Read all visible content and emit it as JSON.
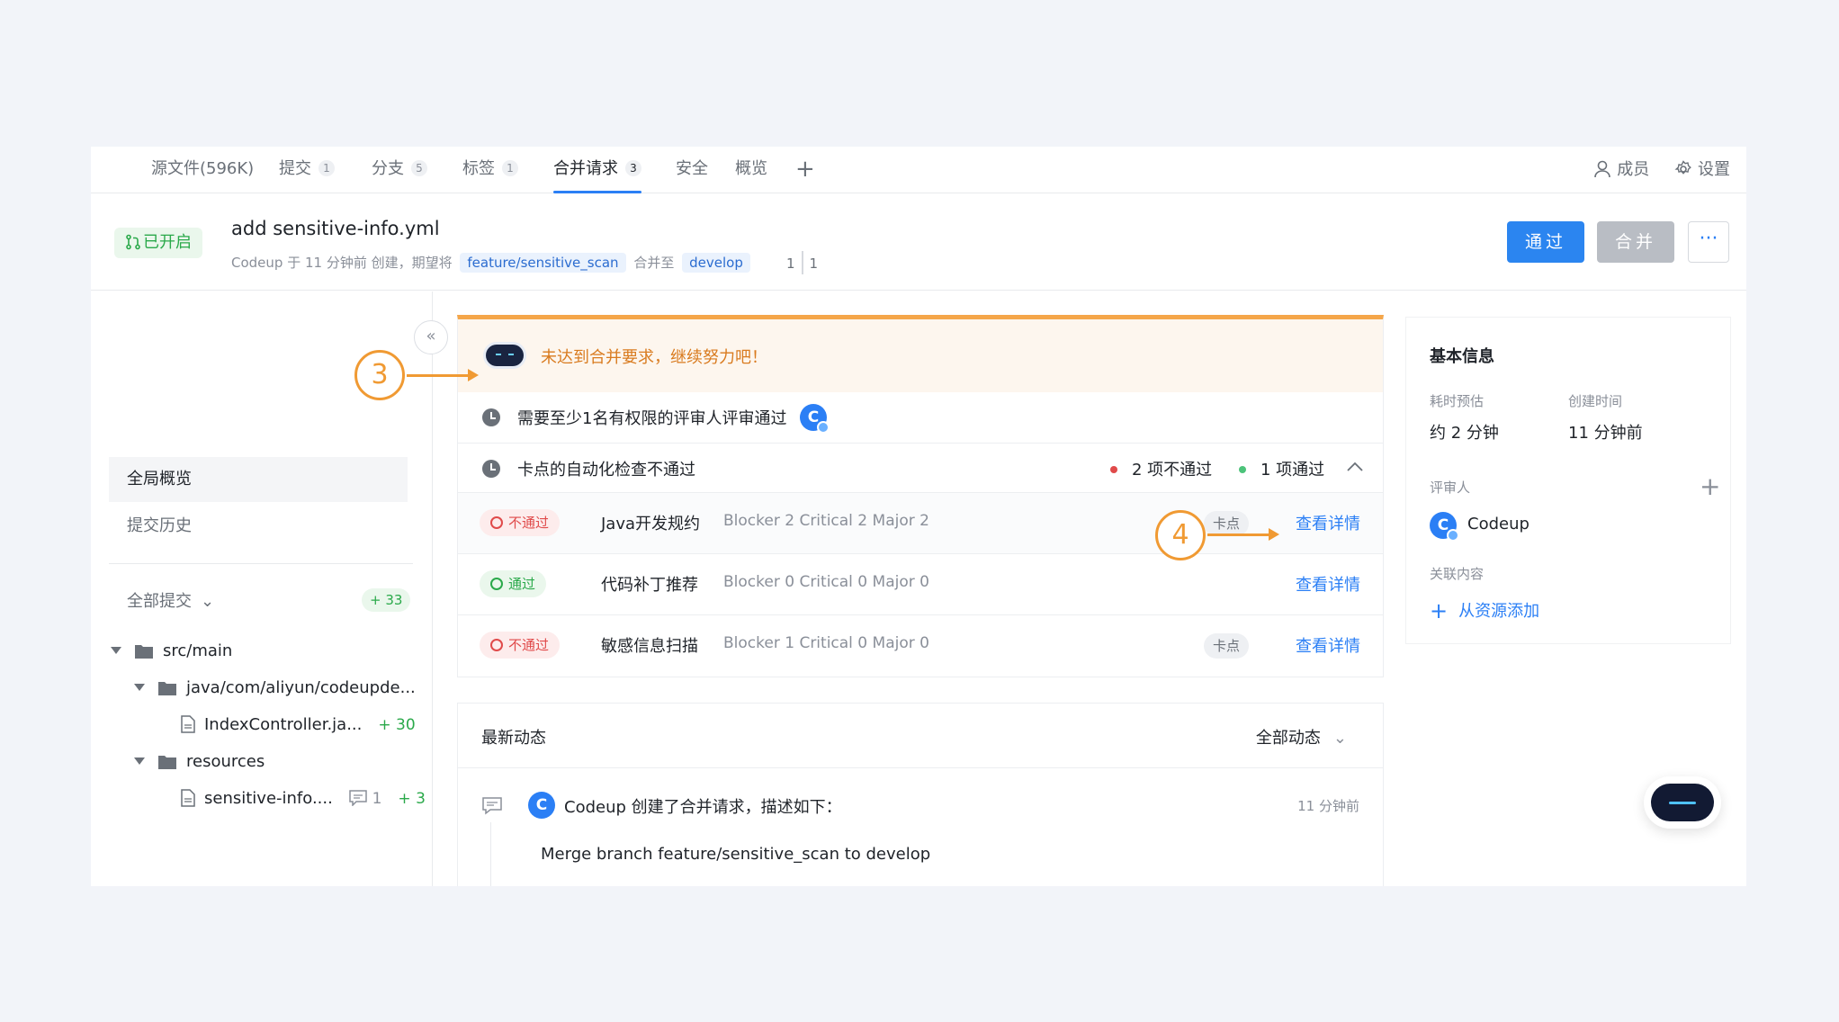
{
  "tabs": [
    {
      "label": "源文件(596K)",
      "count": ""
    },
    {
      "label": "提交",
      "count": "1"
    },
    {
      "label": "分支",
      "count": "5"
    },
    {
      "label": "标签",
      "count": "1"
    },
    {
      "label": "合并请求",
      "count": "3"
    },
    {
      "label": "安全",
      "count": ""
    },
    {
      "label": "概览",
      "count": ""
    }
  ],
  "topright": {
    "members": "成员",
    "settings": "设置"
  },
  "pr": {
    "status": "已开启",
    "title": "add sensitive-info.yml",
    "sub_prefix": "Codeup 于 11 分钟前 创建，期望将",
    "source_branch": "feature/sensitive_scan",
    "merge_to": "合并至",
    "target_branch": "develop",
    "diff_del": "1",
    "diff_add": "1"
  },
  "actions": {
    "pass": "通过",
    "merge": "合并",
    "more": "···"
  },
  "sidebar": {
    "overview": "全局概览",
    "history": "提交历史",
    "all_commits": "全部提交",
    "commits_count": "+ 33",
    "tree": [
      {
        "name": "src/main"
      },
      {
        "name": "java/com/aliyun/codeupde..."
      },
      {
        "name": "IndexController.ja...",
        "add": "+ 30"
      },
      {
        "name": "resources"
      },
      {
        "name": "sensitive-info....",
        "comments": "1",
        "add": "+ 3"
      }
    ]
  },
  "checks": {
    "warning": "未达到合并要求，继续努力吧！",
    "review_req": "需要至少1名有权限的评审人评审通过",
    "auto_check": "卡点的自动化检查不通过",
    "fail_summary": "2 项不通过",
    "pass_summary": "1 项通过",
    "scans": [
      {
        "status": "不通过",
        "name": "Java开发规约",
        "detail": "Blocker 2 Critical 2 Major 2",
        "gate": "卡点",
        "link": "查看详情"
      },
      {
        "status": "通过",
        "name": "代码补丁推荐",
        "detail": "Blocker 0 Critical 0 Major 0",
        "gate": "",
        "link": "查看详情"
      },
      {
        "status": "不通过",
        "name": "敏感信息扫描",
        "detail": "Blocker 1 Critical 0 Major 0",
        "gate": "卡点",
        "link": "查看详情"
      }
    ]
  },
  "activity": {
    "title": "最新动态",
    "filter": "全部动态",
    "author": "Codeup",
    "text": "创建了合并请求，描述如下：",
    "time": "11 分钟前",
    "description": "Merge branch feature/sensitive_scan to develop"
  },
  "info": {
    "title": "基本信息",
    "est_label": "耗时预估",
    "est_value": "约 2 分钟",
    "created_label": "创建时间",
    "created_value": "11 分钟前",
    "reviewer_label": "评审人",
    "reviewer_name": "Codeup",
    "related_label": "关联内容",
    "add_resource": "从资源添加"
  },
  "annotations": {
    "a3": "3",
    "a4": "4"
  },
  "colors": {
    "accent": "#2b85f0",
    "success": "#2aa94a",
    "danger": "#e04a4a",
    "warning": "#f5a649",
    "annotation": "#f09a33"
  }
}
